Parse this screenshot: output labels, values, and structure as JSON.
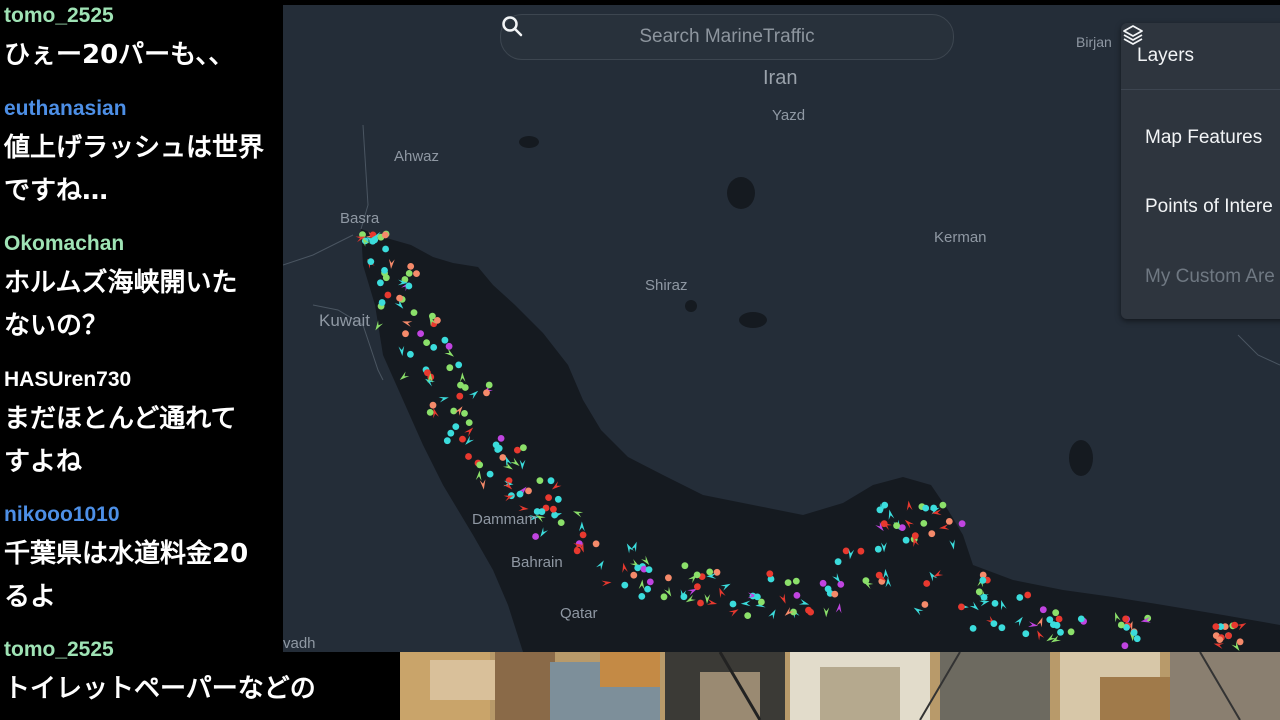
{
  "chat": [
    {
      "user": "tomo_2525",
      "user_color": "#9fe3b5",
      "lines": [
        "ひぇー20パーも、、"
      ]
    },
    {
      "user": "euthanasian",
      "user_color": "#4d8fe6",
      "lines": [
        "値上げラッシュは世界",
        "ですね…"
      ]
    },
    {
      "user": "Okomachan",
      "user_color": "#9fe3b5",
      "lines": [
        "ホルムズ海峡開いた",
        "ないの？"
      ]
    },
    {
      "user": "HASUren730",
      "user_color": "#ffffff",
      "lines": [
        "まだほとんど通れて",
        "すよね"
      ]
    },
    {
      "user": "nikooo1010",
      "user_color": "#4d8fe6",
      "lines": [
        "千葉県は水道料金20",
        "るよ"
      ]
    },
    {
      "user": "tomo_2525",
      "user_color": "#9fe3b5",
      "lines": [
        "トイレットペーパーなどの"
      ]
    }
  ],
  "map": {
    "search_placeholder": "Search MarineTraffic",
    "places": {
      "iran": "Iran",
      "yazd": "Yazd",
      "ahwaz": "Ahwaz",
      "basra": "Basra",
      "kuwait": "Kuwait",
      "shiraz": "Shiraz",
      "kerman": "Kerman",
      "dammam": "Dammam",
      "bahrain": "Bahrain",
      "qatar": "Qatar",
      "riyadh": "vadh",
      "birjand": "Birjan"
    },
    "layers_panel": {
      "title": "Layers",
      "items": [
        "Map Features",
        "Points of Intere",
        "My Custom Are"
      ]
    },
    "colors": {
      "land": "#242d38",
      "sea": "#151a20",
      "cargo": "#8be06a",
      "tanker": "#e8392f",
      "passenger": "#3bdcdc",
      "fishing": "#f58a6a",
      "pleasure": "#c044e0"
    }
  }
}
